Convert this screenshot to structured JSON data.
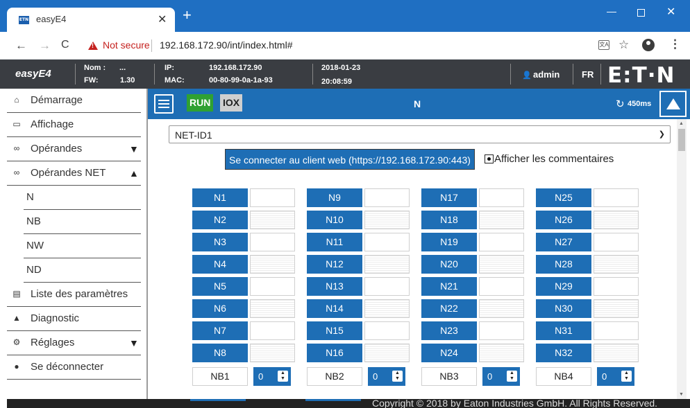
{
  "browser": {
    "tab_title": "easyE4",
    "tab_favicon": "ETN",
    "not_secure": "Not secure",
    "url": "192.168.172.90/int/index.html#"
  },
  "header": {
    "brand": "easyE4",
    "nom_label": "Nom :",
    "nom_value": "...",
    "fw_label": "FW:",
    "fw_value": "1.30",
    "ip_label": "IP:",
    "ip_value": "192.168.172.90",
    "mac_label": "MAC:",
    "mac_value": "00-80-99-0a-1a-93",
    "date": "2018-01-23",
    "time": "20:08:59",
    "user": "admin",
    "lang": "FR",
    "logo": "E:T·N"
  },
  "sidebar": {
    "items": [
      {
        "label": "Démarrage",
        "icon": "home-icon"
      },
      {
        "label": "Affichage",
        "icon": "monitor-icon"
      },
      {
        "label": "Opérandes",
        "icon": "infinity-icon"
      },
      {
        "label": "Opérandes NET",
        "icon": "infinity-icon"
      },
      {
        "label": "N"
      },
      {
        "label": "NB"
      },
      {
        "label": "NW"
      },
      {
        "label": "ND"
      },
      {
        "label": "Liste des paramètres",
        "icon": "list-icon"
      },
      {
        "label": "Diagnostic",
        "icon": "warning-icon"
      },
      {
        "label": "Réglages",
        "icon": "gear-icon"
      },
      {
        "label": "Se déconnecter",
        "icon": "user-icon"
      }
    ]
  },
  "toolbar": {
    "run": "RUN",
    "iox": "IOX",
    "title": "N",
    "cycle": "450ms"
  },
  "main": {
    "net_select": "NET-ID1",
    "connect_button": "Se connecter au client web (https://192.168.172.90:443)",
    "comments_label": "Afficher les commentaires",
    "n_columns": [
      [
        "N1",
        "N2",
        "N3",
        "N4",
        "N5",
        "N6",
        "N7",
        "N8"
      ],
      [
        "N9",
        "N10",
        "N11",
        "N12",
        "N13",
        "N14",
        "N15",
        "N16"
      ],
      [
        "N17",
        "N18",
        "N19",
        "N20",
        "N21",
        "N22",
        "N23",
        "N24"
      ],
      [
        "N25",
        "N26",
        "N27",
        "N28",
        "N29",
        "N30",
        "N31",
        "N32"
      ]
    ],
    "nb": [
      {
        "label": "NB1",
        "value": "0"
      },
      {
        "label": "NB2",
        "value": "0"
      },
      {
        "label": "NB3",
        "value": "0"
      },
      {
        "label": "NB4",
        "value": "0"
      }
    ]
  },
  "footer": {
    "copyright": "Copyright © 2018 by Eaton Industries GmbH. All Rights Reserved."
  },
  "colors": {
    "accent_blue": "#1e6eb5",
    "header_dark": "#3a3d42",
    "run_green": "#2fa132",
    "chrome_blue": "#1f6fc2"
  }
}
